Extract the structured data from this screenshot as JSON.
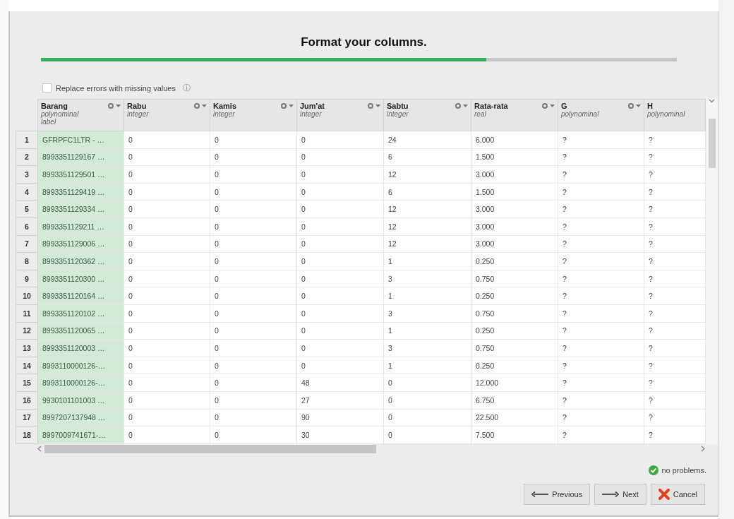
{
  "title": "Format your columns.",
  "progress": {
    "level": 0.7
  },
  "replace_errors": {
    "label": "Replace errors with missing values",
    "checked": false,
    "info": "ⓘ"
  },
  "table": {
    "columns": [
      {
        "name": "Barang",
        "type": "polynominal",
        "role": "label",
        "menu": true
      },
      {
        "name": "Rabu",
        "type": "integer",
        "menu": true
      },
      {
        "name": "Kamis",
        "type": "integer",
        "menu": true
      },
      {
        "name": "Jum'at",
        "type": "integer",
        "menu": true
      },
      {
        "name": "Sabtu",
        "type": "integer",
        "menu": true
      },
      {
        "name": "Rata-rata",
        "type": "real",
        "menu": true
      },
      {
        "name": "G",
        "type": "polynominal",
        "menu": true
      },
      {
        "name": "H",
        "type": "polynominal",
        "menu": false
      }
    ],
    "rows": [
      {
        "number": "1",
        "cells": [
          "GFRPFC1LTR - …",
          "0",
          "0",
          "0",
          "24",
          "6.000",
          "?",
          "?"
        ]
      },
      {
        "number": "2",
        "cells": [
          "8993351129167 …",
          "0",
          "0",
          "0",
          "6",
          "1.500",
          "?",
          "?"
        ]
      },
      {
        "number": "3",
        "cells": [
          "8993351129501 …",
          "0",
          "0",
          "0",
          "12",
          "3.000",
          "?",
          "?"
        ]
      },
      {
        "number": "4",
        "cells": [
          "8993351129419 …",
          "0",
          "0",
          "0",
          "6",
          "1.500",
          "?",
          "?"
        ]
      },
      {
        "number": "5",
        "cells": [
          "8993351129334 …",
          "0",
          "0",
          "0",
          "12",
          "3.000",
          "?",
          "?"
        ]
      },
      {
        "number": "6",
        "cells": [
          "8993351129211 …",
          "0",
          "0",
          "0",
          "12",
          "3.000",
          "?",
          "?"
        ]
      },
      {
        "number": "7",
        "cells": [
          "8993351129006 …",
          "0",
          "0",
          "0",
          "12",
          "3.000",
          "?",
          "?"
        ]
      },
      {
        "number": "8",
        "cells": [
          "8993351120362 …",
          "0",
          "0",
          "0",
          "1",
          "0.250",
          "?",
          "?"
        ]
      },
      {
        "number": "9",
        "cells": [
          "8993351120300 …",
          "0",
          "0",
          "0",
          "3",
          "0.750",
          "?",
          "?"
        ]
      },
      {
        "number": "10",
        "cells": [
          "8993351120164 …",
          "0",
          "0",
          "0",
          "1",
          "0.250",
          "?",
          "?"
        ]
      },
      {
        "number": "11",
        "cells": [
          "8993351120102 …",
          "0",
          "0",
          "0",
          "3",
          "0.750",
          "?",
          "?"
        ]
      },
      {
        "number": "12",
        "cells": [
          "8993351120065 …",
          "0",
          "0",
          "0",
          "1",
          "0.250",
          "?",
          "?"
        ]
      },
      {
        "number": "13",
        "cells": [
          "8993351120003 …",
          "0",
          "0",
          "0",
          "3",
          "0.750",
          "?",
          "?"
        ]
      },
      {
        "number": "14",
        "cells": [
          "8993110000126-…",
          "0",
          "0",
          "0",
          "1",
          "0.250",
          "?",
          "?"
        ]
      },
      {
        "number": "15",
        "cells": [
          "8993110000126-…",
          "0",
          "0",
          "48",
          "0",
          "12.000",
          "?",
          "?"
        ]
      },
      {
        "number": "16",
        "cells": [
          "9930101101003 …",
          "0",
          "0",
          "27",
          "0",
          "6.750",
          "?",
          "?"
        ]
      },
      {
        "number": "17",
        "cells": [
          "8997207137948 …",
          "0",
          "0",
          "90",
          "0",
          "22.500",
          "?",
          "?"
        ]
      },
      {
        "number": "18",
        "cells": [
          "8997009741671-…",
          "0",
          "0",
          "30",
          "0",
          "7.500",
          "?",
          "?"
        ]
      }
    ]
  },
  "status": {
    "kind": "ok",
    "text": "no problems."
  },
  "buttons": [
    {
      "kind": "previous",
      "label": "Previous"
    },
    {
      "kind": "next",
      "label": "Next"
    },
    {
      "kind": "cancel",
      "label": "Cancel"
    }
  ]
}
